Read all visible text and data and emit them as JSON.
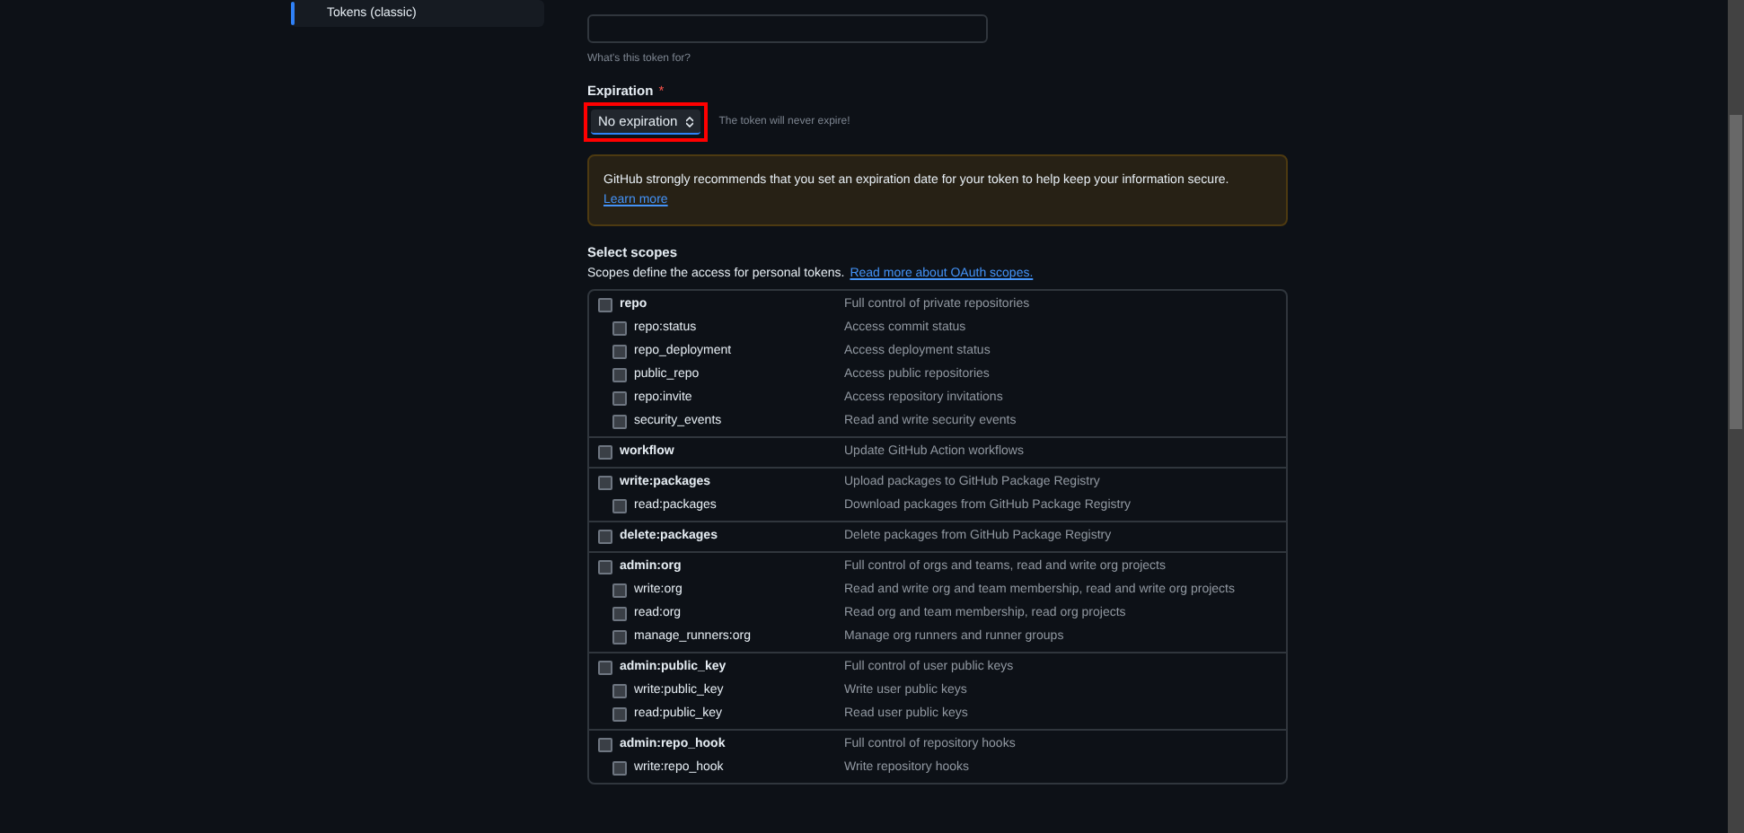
{
  "sidebar": {
    "items": [
      {
        "label": "Tokens (classic)",
        "selected": true
      }
    ]
  },
  "note": {
    "hint": "What's this token for?"
  },
  "expiration": {
    "label": "Expiration",
    "required_mark": "*",
    "value": "No expiration",
    "hint": "The token will never expire!",
    "highlighted": true
  },
  "warning": {
    "text": "GitHub strongly recommends that you set an expiration date for your token to help keep your information secure.",
    "link": "Learn more"
  },
  "scopes": {
    "title": "Select scopes",
    "description": "Scopes define the access for personal tokens.",
    "link": "Read more about OAuth scopes.",
    "groups": [
      {
        "name": "repo",
        "description": "Full control of private repositories",
        "checked": false,
        "children": [
          {
            "name": "repo:status",
            "description": "Access commit status",
            "checked": false
          },
          {
            "name": "repo_deployment",
            "description": "Access deployment status",
            "checked": false
          },
          {
            "name": "public_repo",
            "description": "Access public repositories",
            "checked": false
          },
          {
            "name": "repo:invite",
            "description": "Access repository invitations",
            "checked": false
          },
          {
            "name": "security_events",
            "description": "Read and write security events",
            "checked": false
          }
        ]
      },
      {
        "name": "workflow",
        "description": "Update GitHub Action workflows",
        "checked": false
      },
      {
        "name": "write:packages",
        "description": "Upload packages to GitHub Package Registry",
        "checked": false,
        "children": [
          {
            "name": "read:packages",
            "description": "Download packages from GitHub Package Registry",
            "checked": false
          }
        ]
      },
      {
        "name": "delete:packages",
        "description": "Delete packages from GitHub Package Registry",
        "checked": false
      },
      {
        "name": "admin:org",
        "description": "Full control of orgs and teams, read and write org projects",
        "checked": false,
        "children": [
          {
            "name": "write:org",
            "description": "Read and write org and team membership, read and write org projects",
            "checked": false
          },
          {
            "name": "read:org",
            "description": "Read org and team membership, read org projects",
            "checked": false
          },
          {
            "name": "manage_runners:org",
            "description": "Manage org runners and runner groups",
            "checked": false
          }
        ]
      },
      {
        "name": "admin:public_key",
        "description": "Full control of user public keys",
        "checked": false,
        "children": [
          {
            "name": "write:public_key",
            "description": "Write user public keys",
            "checked": false
          },
          {
            "name": "read:public_key",
            "description": "Read user public keys",
            "checked": false
          }
        ]
      },
      {
        "name": "admin:repo_hook",
        "description": "Full control of repository hooks",
        "checked": false,
        "children": [
          {
            "name": "write:repo_hook",
            "description": "Write repository hooks",
            "checked": false
          }
        ]
      }
    ]
  }
}
